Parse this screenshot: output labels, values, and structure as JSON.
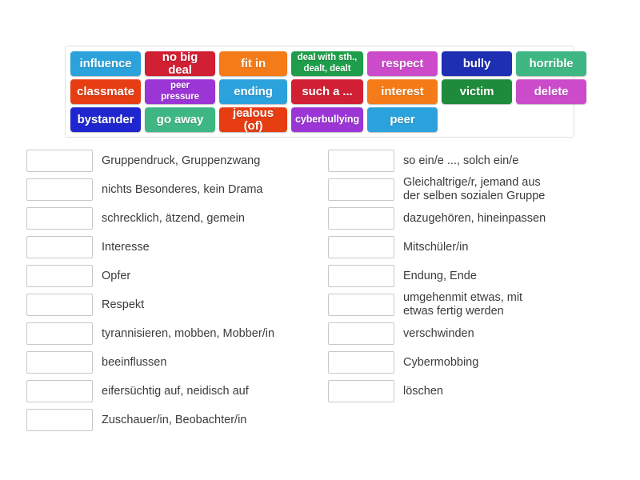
{
  "word_bank": {
    "rows": [
      [
        {
          "label": "influence",
          "color": "#2BA2DB",
          "style": "normal"
        },
        {
          "label": "no big deal",
          "color": "#D11F34",
          "style": "normal"
        },
        {
          "label": "fit in",
          "color": "#F47B17",
          "style": "normal"
        },
        {
          "label": "deal with sth.,\ndealt, dealt",
          "color": "#1E9E4A",
          "style": "two-line"
        },
        {
          "label": "respect",
          "color": "#CB4BCB",
          "style": "normal"
        },
        {
          "label": "bully",
          "color": "#1E2FB4",
          "style": "normal"
        },
        {
          "label": "horrible",
          "color": "#3FB784",
          "style": "normal"
        }
      ],
      [
        {
          "label": "classmate",
          "color": "#E73D13",
          "style": "normal"
        },
        {
          "label": "peer\npressure",
          "color": "#9B35D6",
          "style": "two-line"
        },
        {
          "label": "ending",
          "color": "#2BA2DB",
          "style": "normal"
        },
        {
          "label": "such a ...",
          "color": "#D11F34",
          "style": "normal"
        },
        {
          "label": "interest",
          "color": "#F47B17",
          "style": "normal"
        },
        {
          "label": "victim",
          "color": "#1E8A3C",
          "style": "normal"
        },
        {
          "label": "delete",
          "color": "#CB4BCB",
          "style": "normal"
        }
      ],
      [
        {
          "label": "bystander",
          "color": "#2026CF",
          "style": "normal"
        },
        {
          "label": "go away",
          "color": "#3FB784",
          "style": "normal"
        },
        {
          "label": "jealous (of)",
          "color": "#E73D13",
          "style": "normal"
        },
        {
          "label": "cyberbullying",
          "color": "#9B35D6",
          "style": "small"
        },
        {
          "label": "peer",
          "color": "#2BA2DB",
          "style": "normal"
        }
      ]
    ],
    "tile_widths": [
      [
        88,
        88,
        85,
        90,
        88,
        88,
        88
      ],
      [
        88,
        88,
        85,
        90,
        88,
        88,
        88
      ],
      [
        88,
        88,
        85,
        90,
        88
      ]
    ]
  },
  "left_column": [
    {
      "definition": "Gruppendruck, Gruppenzwang"
    },
    {
      "definition": "nichts Besonderes, kein Drama"
    },
    {
      "definition": "schrecklich, ätzend, gemein"
    },
    {
      "definition": "Interesse"
    },
    {
      "definition": "Opfer"
    },
    {
      "definition": "Respekt"
    },
    {
      "definition": "tyrannisieren, mobben, Mobber/in"
    },
    {
      "definition": "beeinflussen"
    },
    {
      "definition": "eifersüchtig auf, neidisch auf"
    },
    {
      "definition": "Zuschauer/in, Beobachter/in"
    }
  ],
  "right_column": [
    {
      "definition": "so ein/e ..., solch ein/e"
    },
    {
      "definition": "Gleichaltrige/r, jemand aus\nder selben sozialen Gruppe"
    },
    {
      "definition": "dazugehören, hineinpassen"
    },
    {
      "definition": "Mitschüler/in"
    },
    {
      "definition": "Endung, Ende"
    },
    {
      "definition": "umgehenmit etwas, mit\netwas fertig werden"
    },
    {
      "definition": "verschwinden"
    },
    {
      "definition": "Cybermobbing"
    },
    {
      "definition": "löschen"
    }
  ],
  "drop_box_placeholder": ""
}
